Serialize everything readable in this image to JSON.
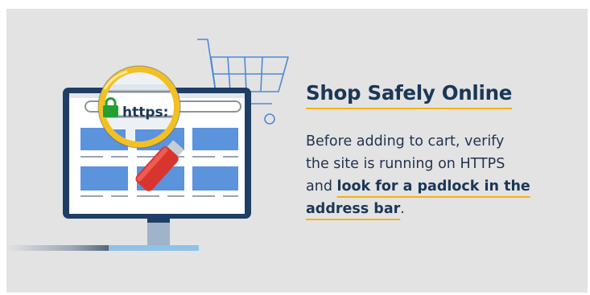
{
  "illustration": {
    "address_bar_text": "https:",
    "icons": [
      "padlock-icon",
      "shopping-cart-icon",
      "magnifying-glass-icon",
      "computer-monitor-icon"
    ]
  },
  "content": {
    "title": "Shop Safely Online",
    "body_line_1": "Before adding to cart, verify",
    "body_line_2": "the site is running on HTTPS",
    "body_line_3_plain": "and ",
    "highlight_part_1": "look for a padlock in the",
    "highlight_part_2": "address bar",
    "period": "."
  },
  "colors": {
    "background": "#e3e3e3",
    "title": "#1b3756",
    "accent_underline": "#f3b21a",
    "monitor_frame": "#1f3e66",
    "tile_blue": "#5b93dd",
    "padlock_green": "#22a033",
    "magnifier_handle": "#d9352f",
    "magnifier_rim": "#f3c024"
  }
}
